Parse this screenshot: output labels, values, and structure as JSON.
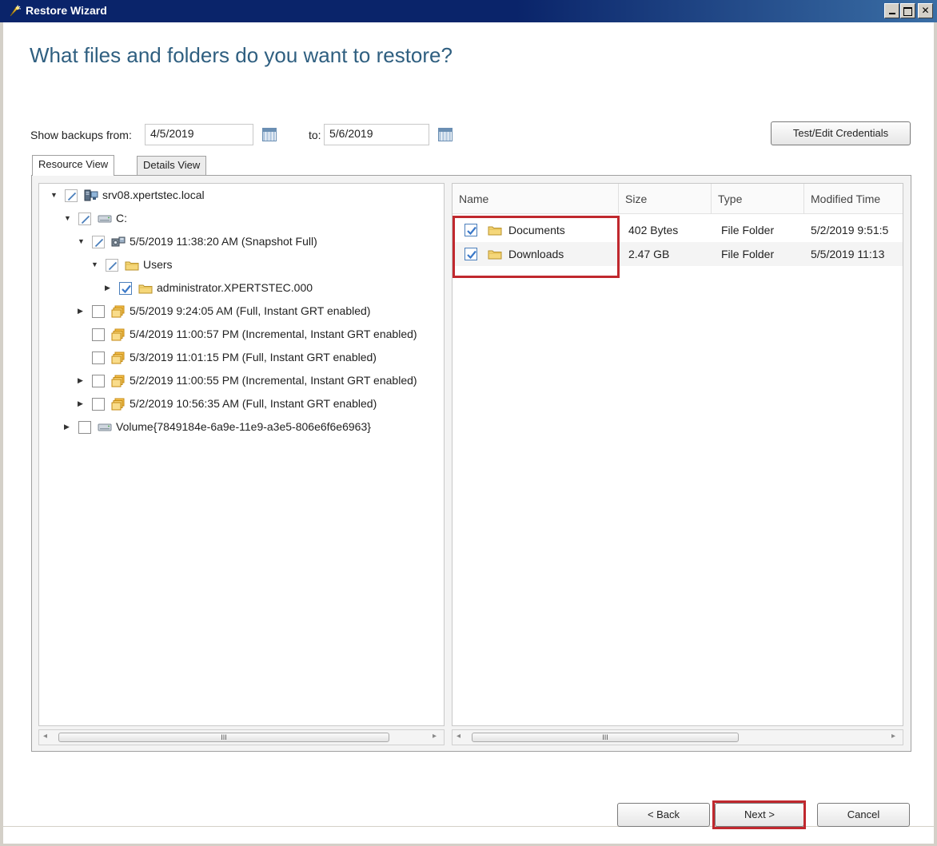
{
  "window": {
    "title": "Restore Wizard"
  },
  "page": {
    "heading": "What files and folders do you want to restore?"
  },
  "filter": {
    "from_label": "Show backups from:",
    "from_value": "4/5/2019",
    "to_label": "to:",
    "to_value": "5/6/2019"
  },
  "buttons": {
    "test_edit_credentials": "Test/Edit Credentials",
    "back": "< Back",
    "next": "Next >",
    "cancel": "Cancel"
  },
  "tabs": [
    {
      "label": "Resource View",
      "active": true
    },
    {
      "label": "Details View",
      "active": false
    }
  ],
  "tree": [
    {
      "label": "srv08.xpertstec.local",
      "level": 0,
      "expander": "expanded",
      "check": "partial",
      "icon": "server-icon"
    },
    {
      "label": "C:",
      "level": 1,
      "expander": "expanded",
      "check": "partial",
      "icon": "drive-icon"
    },
    {
      "label": "5/5/2019 11:38:20 AM (Snapshot Full)",
      "level": 2,
      "expander": "expanded",
      "check": "partial",
      "icon": "snapshot-icon"
    },
    {
      "label": "Users",
      "level": 3,
      "expander": "expanded",
      "check": "partial",
      "icon": "folder-icon"
    },
    {
      "label": "administrator.XPERTSTEC.000",
      "level": 4,
      "expander": "collapsed",
      "check": "checked",
      "icon": "folder-icon"
    },
    {
      "label": "5/5/2019 9:24:05 AM (Full, Instant GRT enabled)",
      "level": 2,
      "expander": "collapsed",
      "check": "unchecked",
      "icon": "backup-set-icon"
    },
    {
      "label": "5/4/2019 11:00:57 PM (Incremental, Instant GRT enabled)",
      "level": 2,
      "expander": "none",
      "check": "unchecked",
      "icon": "backup-set-icon"
    },
    {
      "label": "5/3/2019 11:01:15 PM (Full, Instant GRT enabled)",
      "level": 2,
      "expander": "none",
      "check": "unchecked",
      "icon": "backup-set-icon"
    },
    {
      "label": "5/2/2019 11:00:55 PM (Incremental, Instant GRT enabled)",
      "level": 2,
      "expander": "collapsed",
      "check": "unchecked",
      "icon": "backup-set-icon"
    },
    {
      "label": "5/2/2019 10:56:35 AM (Full, Instant GRT enabled)",
      "level": 2,
      "expander": "collapsed",
      "check": "unchecked",
      "icon": "backup-set-icon"
    },
    {
      "label": "Volume{7849184e-6a9e-11e9-a3e5-806e6f6e6963}",
      "level": 1,
      "expander": "collapsed",
      "check": "unchecked",
      "icon": "drive-icon"
    }
  ],
  "files": {
    "columns": [
      "Name",
      "Size",
      "Type",
      "Modified Time"
    ],
    "rows": [
      {
        "name": "Documents",
        "size": "402 Bytes",
        "type": "File Folder",
        "modified": "5/2/2019 9:51:5",
        "checked": true
      },
      {
        "name": "Downloads",
        "size": "2.47 GB",
        "type": "File Folder",
        "modified": "5/5/2019 11:13",
        "checked": true
      }
    ]
  },
  "scrollbars": {
    "thumb_glyph": "III"
  },
  "colors": {
    "heading": "#2f5f80",
    "highlight": "#c0282e",
    "check": "#3a78c8"
  }
}
